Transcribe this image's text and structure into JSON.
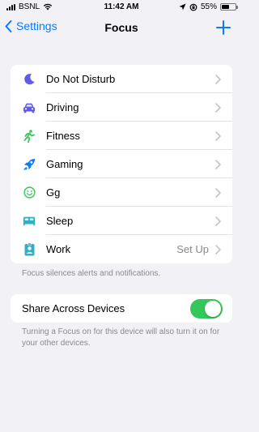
{
  "status_bar": {
    "carrier": "BSNL",
    "time": "11:42 AM",
    "battery": "55%",
    "battery_level": 0.55
  },
  "nav": {
    "back_label": "Settings",
    "title": "Focus"
  },
  "focus_modes": [
    {
      "label": "Do Not Disturb",
      "icon": "moon-icon",
      "color": "#5e5ce6"
    },
    {
      "label": "Driving",
      "icon": "car-icon",
      "color": "#5e5ce6"
    },
    {
      "label": "Fitness",
      "icon": "running-icon",
      "color": "#34c759"
    },
    {
      "label": "Gaming",
      "icon": "rocket-icon",
      "color": "#0a7aff"
    },
    {
      "label": "Gg",
      "icon": "smiley-icon",
      "color": "#34c759"
    },
    {
      "label": "Sleep",
      "icon": "bed-icon",
      "color": "#30b0c7"
    },
    {
      "label": "Work",
      "icon": "work-badge-icon",
      "color": "#30b0c7",
      "value": "Set Up"
    }
  ],
  "focus_footer": "Focus silences alerts and notifications.",
  "share": {
    "label": "Share Across Devices",
    "enabled": true,
    "footer": "Turning a Focus on for this device will also turn it on for your other devices."
  },
  "colors": {
    "accent": "#0a7aff",
    "toggle_on": "#34c759",
    "background": "#f2f2f6"
  }
}
